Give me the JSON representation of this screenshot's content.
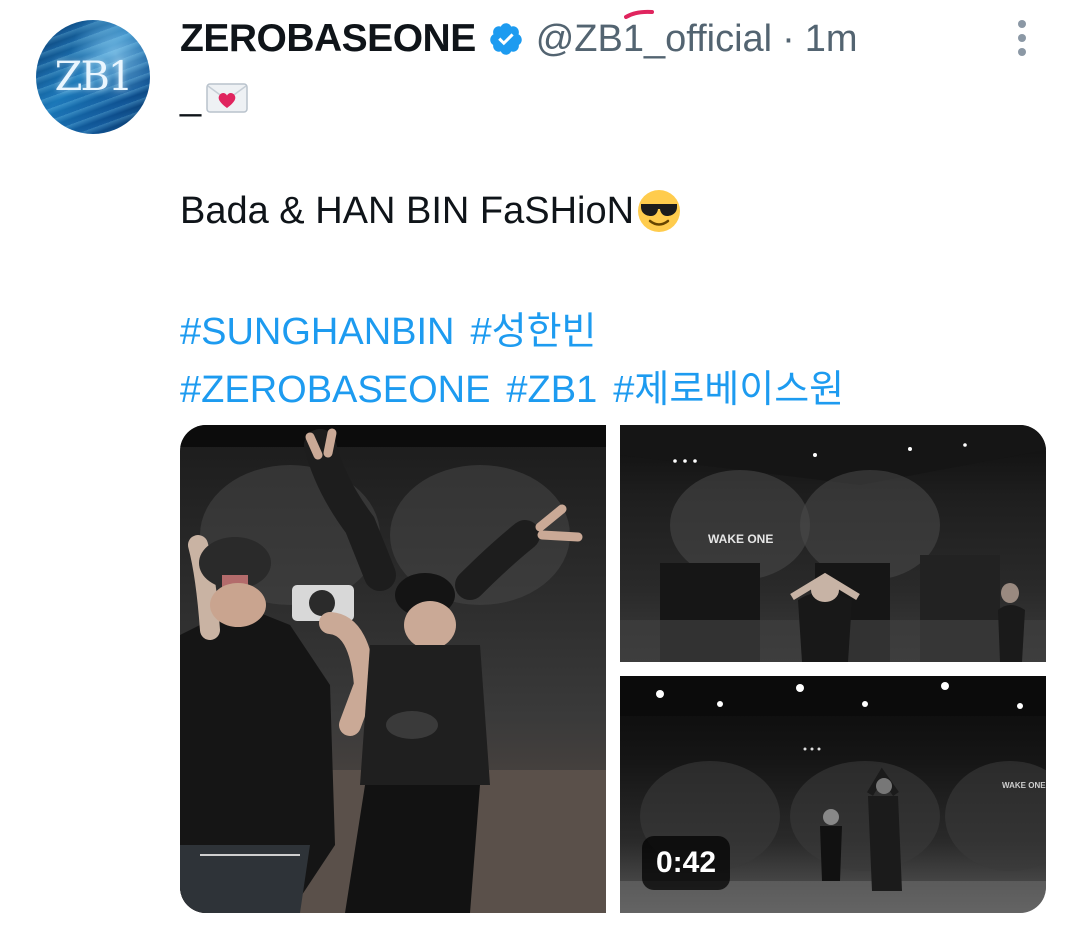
{
  "tweet": {
    "author_name": "ZEROBASEONE",
    "handle": "@ZB1_official",
    "separator": "·",
    "time": "1m",
    "avatar_text": "ZB1",
    "text_prefix": "_",
    "text_body": "Bada & HAN BIN FaSHioN",
    "hashtags_line1": [
      "#SUNGHANBIN",
      "#성한빈"
    ],
    "hashtags_line2": [
      "#ZEROBASEONE",
      "#ZB1",
      "#제로베이스원"
    ]
  },
  "icons": {
    "verified": "verified-badge-icon",
    "more": "more-options-icon",
    "envelope": "love-letter-emoji",
    "sunglasses": "sunglasses-face-emoji"
  },
  "media": {
    "sign_text": "WAKE ONE",
    "video_duration": "0:42"
  },
  "colors": {
    "link": "#1d9bf0",
    "secondary_text": "#536471",
    "verified": "#1d9bf0"
  }
}
